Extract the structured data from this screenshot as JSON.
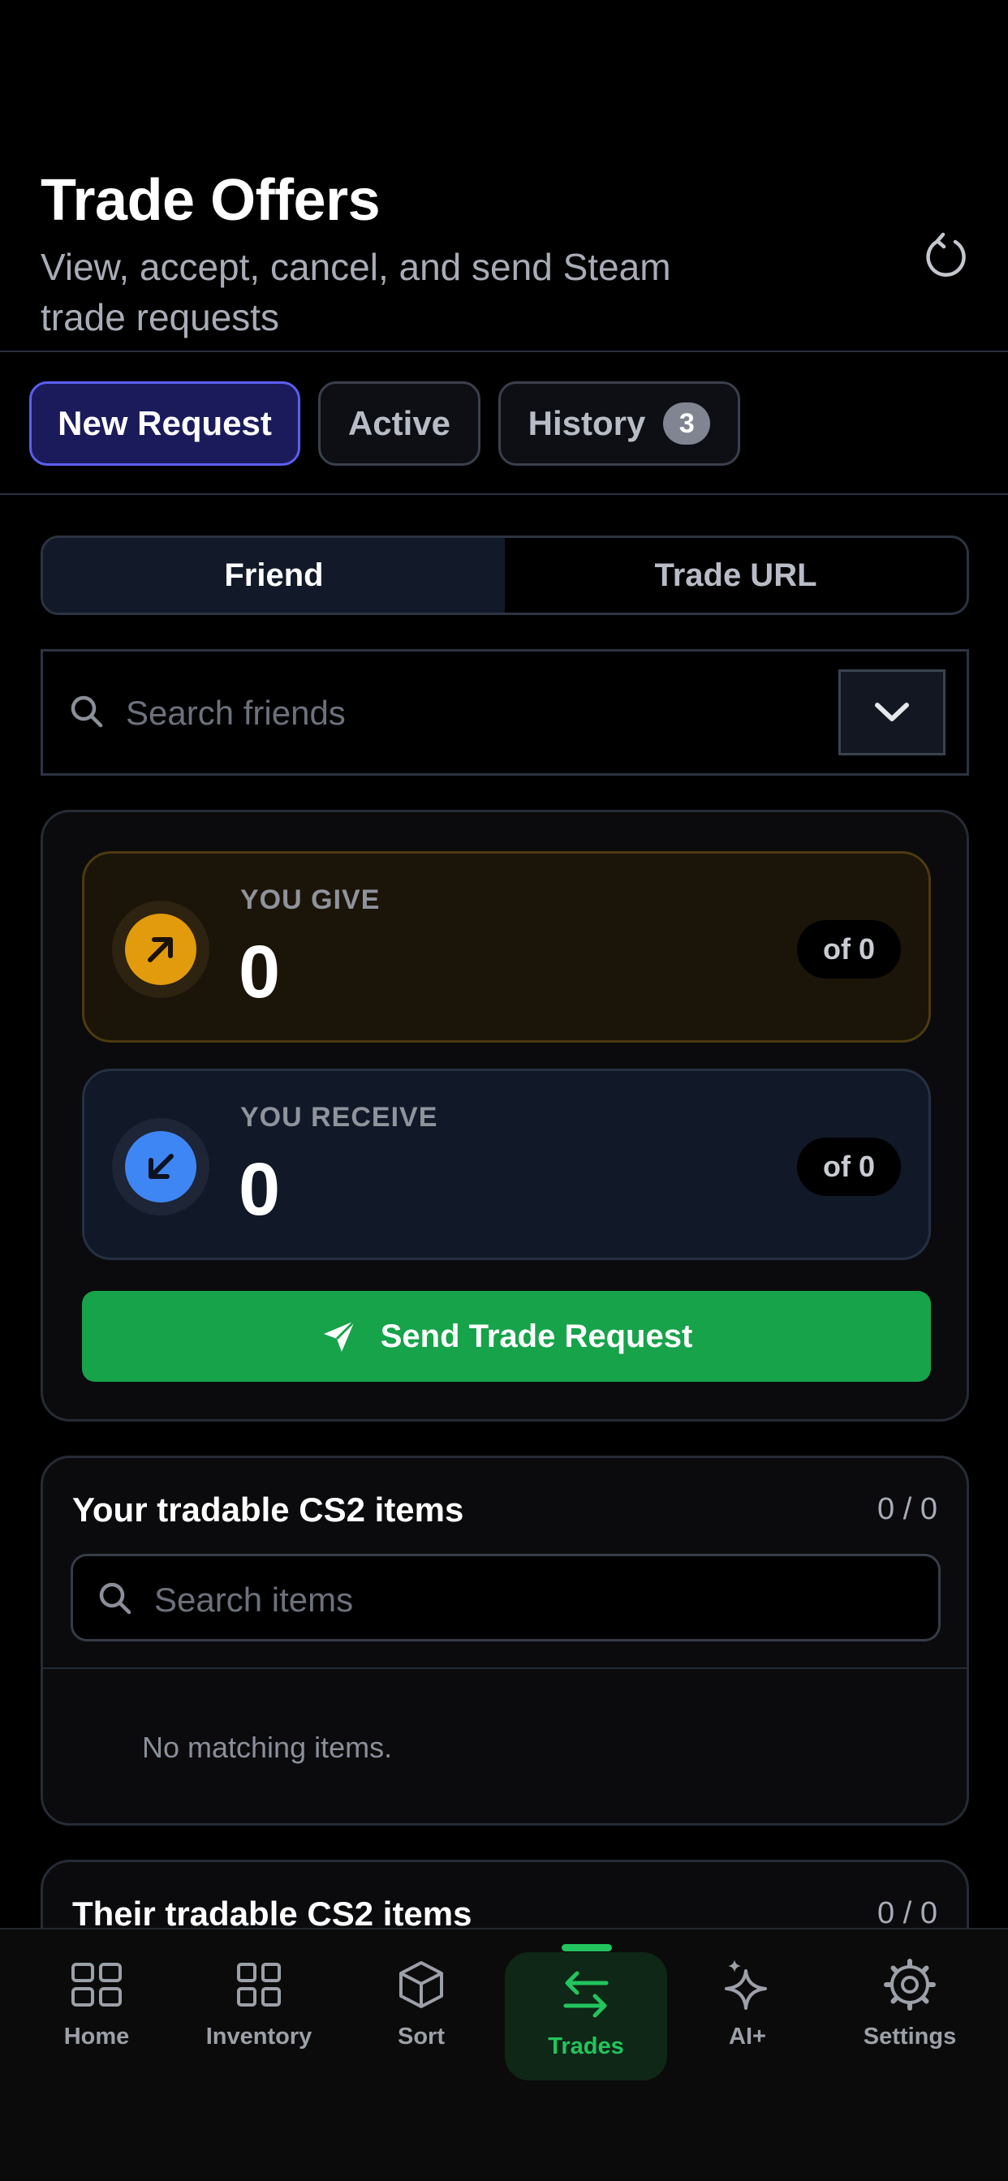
{
  "header": {
    "title": "Trade Offers",
    "subtitle": "View, accept, cancel, and send Steam trade requests"
  },
  "icons": {
    "refresh": "refresh-icon",
    "search": "search-icon",
    "chevron": "chevron-down-icon",
    "give": "arrow-up-right-icon",
    "receive": "arrow-down-left-icon",
    "send": "paper-plane-icon"
  },
  "tabs": [
    {
      "label": "New Request",
      "active": true
    },
    {
      "label": "Active",
      "active": false
    },
    {
      "label": "History",
      "active": false,
      "badge": "3"
    }
  ],
  "segment": {
    "options": [
      "Friend",
      "Trade URL"
    ],
    "selected": "Friend"
  },
  "friend_search": {
    "placeholder": "Search friends"
  },
  "give": {
    "label": "YOU GIVE",
    "count": "0",
    "of": "of 0"
  },
  "receive": {
    "label": "YOU RECEIVE",
    "count": "0",
    "of": "of 0"
  },
  "send_button": {
    "label": "Send Trade Request"
  },
  "your_items": {
    "title": "Your tradable CS2 items",
    "count": "0 / 0",
    "search_placeholder": "Search items",
    "empty_text": "No matching items."
  },
  "their_items": {
    "title": "Their tradable CS2 items",
    "count": "0 / 0"
  },
  "tabbar": {
    "items": [
      {
        "label": "Home",
        "icon": "grid-icon"
      },
      {
        "label": "Inventory",
        "icon": "grid-icon"
      },
      {
        "label": "Sort",
        "icon": "box-icon"
      },
      {
        "label": "Trades",
        "icon": "swap-arrows-icon",
        "active": true
      },
      {
        "label": "AI+",
        "icon": "sparkles-icon"
      },
      {
        "label": "Settings",
        "icon": "gear-icon"
      }
    ]
  },
  "colors": {
    "accent_active_tab": "#5b5ff0",
    "give_accent": "#e29b0c",
    "receive_accent": "#3e86f3",
    "send_button": "#16a34a",
    "nav_active": "#22c55e"
  }
}
